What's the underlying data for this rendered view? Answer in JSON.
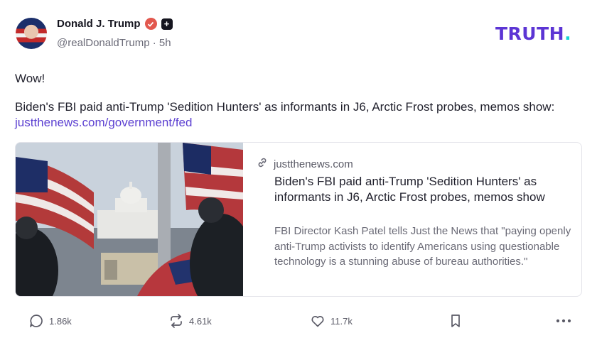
{
  "author": {
    "display_name": "Donald J. Trump",
    "handle": "@realDonaldTrump",
    "time": "· 5h"
  },
  "brand": {
    "logo_main": "TRUTH",
    "logo_dot": "."
  },
  "post": {
    "line1": "Wow!",
    "text": "Biden's FBI paid anti-Trump 'Sedition Hunters' as informants in J6, Arctic Frost probes, memos show: ",
    "link_text": "justthenews.com/government/fed"
  },
  "card": {
    "domain": "justthenews.com",
    "title": "Biden's FBI paid anti-Trump 'Sedition Hunters' as informants in J6, Arctic Frost probes, memos show",
    "description": "FBI Director Kash Patel tells Just the News that \"paying openly anti-Trump activists to identify Americans using questionable technology is a stunning abuse of bureau authorities.\""
  },
  "actions": {
    "replies": "1.86k",
    "retruths": "4.61k",
    "likes": "11.7k"
  },
  "colors": {
    "brand": "#5c35d4",
    "link": "#5b3fd1",
    "verified": "#e2584e",
    "logo_dot": "#17d3d3"
  }
}
